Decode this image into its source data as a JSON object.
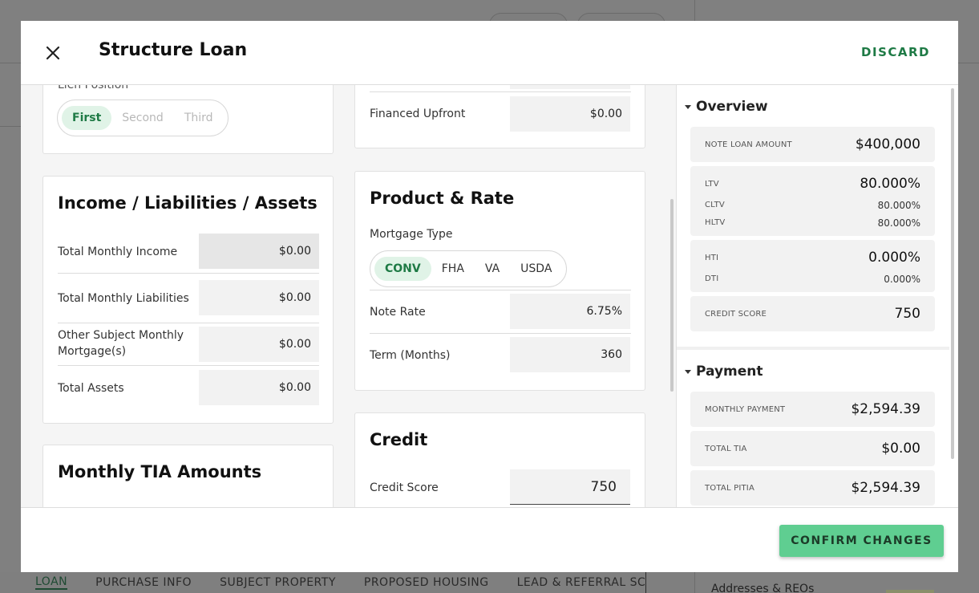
{
  "modal": {
    "title": "Structure Loan",
    "discard_label": "DISCARD",
    "confirm_label": "CONFIRM CHANGES"
  },
  "lien": {
    "label": "Lien Position",
    "options": [
      "First",
      "Second",
      "Third"
    ],
    "selected": "First"
  },
  "income_card": {
    "title": "Income / Liabilities / Assets",
    "rows": [
      {
        "label": "Total Monthly Income",
        "value": "$0.00"
      },
      {
        "label": "Total Monthly Liabilities",
        "value": "$0.00"
      },
      {
        "label": "Other Subject Monthly Mortgage(s)",
        "value": "$0.00"
      },
      {
        "label": "Total Assets",
        "value": "$0.00"
      }
    ]
  },
  "tia_card": {
    "title": "Monthly TIA Amounts"
  },
  "financed": {
    "label": "Financed Upfront",
    "value": "$0.00"
  },
  "product_card": {
    "title": "Product & Rate",
    "mortgage_type_label": "Mortgage Type",
    "mortgage_types": [
      "CONV",
      "FHA",
      "VA",
      "USDA"
    ],
    "selected_type": "CONV",
    "rows": [
      {
        "label": "Note Rate",
        "value": "6.75%"
      },
      {
        "label": "Term (Months)",
        "value": "360"
      }
    ]
  },
  "credit_card": {
    "title": "Credit",
    "score_label": "Credit Score",
    "score_value": "750"
  },
  "overview": {
    "title": "Overview",
    "note_loan_amount": {
      "label": "NOTE LOAN AMOUNT",
      "value": "$400,000"
    },
    "ltv": {
      "label": "LTV",
      "value": "80.000%"
    },
    "cltv": {
      "label": "CLTV",
      "value": "80.000%"
    },
    "hltv": {
      "label": "HLTV",
      "value": "80.000%"
    },
    "hti": {
      "label": "HTI",
      "value": "0.000%"
    },
    "dti": {
      "label": "DTI",
      "value": "0.000%"
    },
    "credit_score": {
      "label": "CREDIT SCORE",
      "value": "750"
    }
  },
  "payment": {
    "title": "Payment",
    "monthly_payment": {
      "label": "MONTHLY PAYMENT",
      "value": "$2,594.39"
    },
    "total_tia": {
      "label": "TOTAL TIA",
      "value": "$0.00"
    },
    "total_pitia": {
      "label": "TOTAL PITIA",
      "value": "$2,594.39"
    }
  },
  "background": {
    "tabs": [
      "LOAN",
      "PURCHASE INFO",
      "SUBJECT PROPERTY",
      "PROPOSED HOUSING",
      "LEAD & REFERRAL SC"
    ],
    "right_text": "Addresses & REOs"
  }
}
